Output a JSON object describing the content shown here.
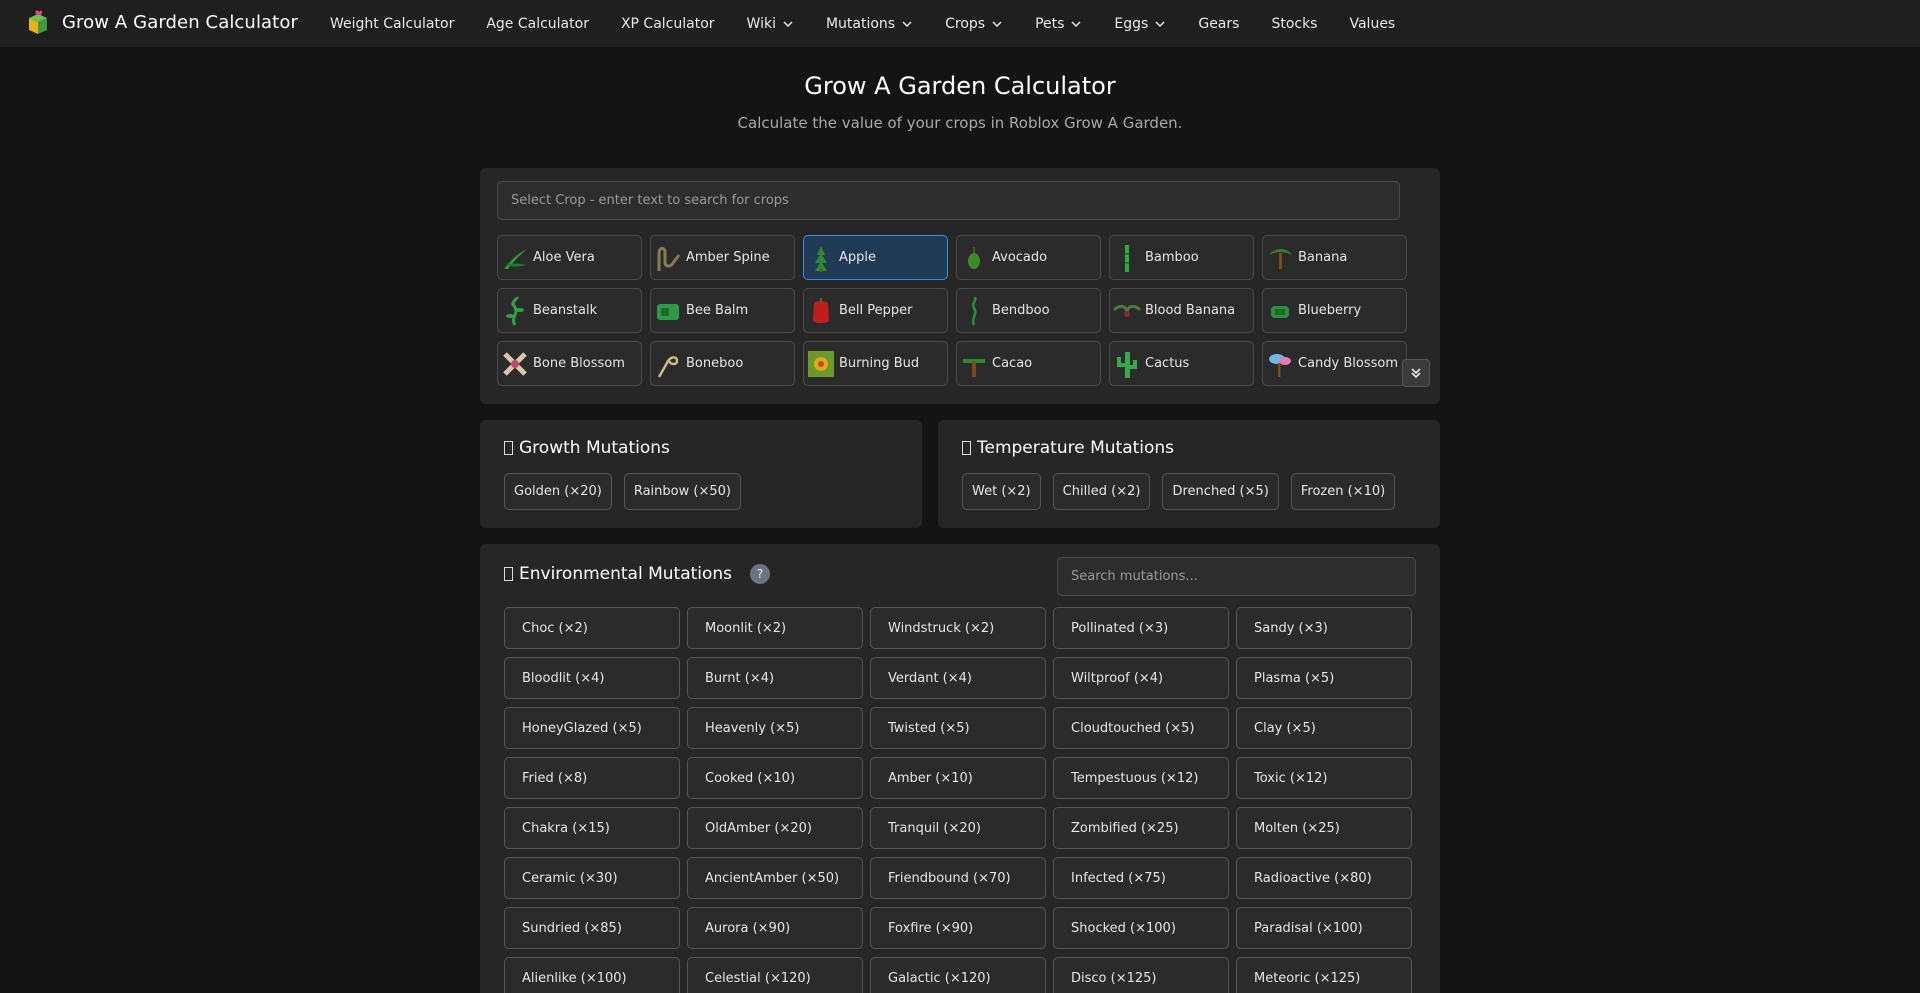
{
  "brand": {
    "title": "Grow A Garden Calculator"
  },
  "nav": [
    {
      "label": "Weight Calculator",
      "dropdown": false
    },
    {
      "label": "Age Calculator",
      "dropdown": false
    },
    {
      "label": "XP Calculator",
      "dropdown": false
    },
    {
      "label": "Wiki",
      "dropdown": true
    },
    {
      "label": "Mutations",
      "dropdown": true
    },
    {
      "label": "Crops",
      "dropdown": true
    },
    {
      "label": "Pets",
      "dropdown": true
    },
    {
      "label": "Eggs",
      "dropdown": true
    },
    {
      "label": "Gears",
      "dropdown": false
    },
    {
      "label": "Stocks",
      "dropdown": false
    },
    {
      "label": "Values",
      "dropdown": false
    }
  ],
  "header": {
    "title": "Grow A Garden Calculator",
    "subtitle": "Calculate the value of your crops in Roblox Grow A Garden."
  },
  "crop_search": {
    "placeholder": "Select Crop - enter text to search for crops",
    "value": ""
  },
  "selected_crop": "Apple",
  "crops": [
    {
      "label": "Aloe Vera",
      "icon": "aloe-vera-icon",
      "color": "#2e9b3a"
    },
    {
      "label": "Amber Spine",
      "icon": "amber-spine-icon",
      "color": "#8a7a52"
    },
    {
      "label": "Apple",
      "icon": "apple-icon",
      "color": "#2f8a2f"
    },
    {
      "label": "Avocado",
      "icon": "avocado-icon",
      "color": "#3a8a2a"
    },
    {
      "label": "Bamboo",
      "icon": "bamboo-icon",
      "color": "#2bab3a"
    },
    {
      "label": "Banana",
      "icon": "banana-icon",
      "color": "#3c7a2c"
    },
    {
      "label": "Beanstalk",
      "icon": "beanstalk-icon",
      "color": "#34a043"
    },
    {
      "label": "Bee Balm",
      "icon": "bee-balm-icon",
      "color": "#2f9a45"
    },
    {
      "label": "Bell Pepper",
      "icon": "bell-pepper-icon",
      "color": "#c01d1d"
    },
    {
      "label": "Bendboo",
      "icon": "bendboo-icon",
      "color": "#2b8e3a"
    },
    {
      "label": "Blood Banana",
      "icon": "blood-banana-icon",
      "color": "#4a7a3a"
    },
    {
      "label": "Blueberry",
      "icon": "blueberry-icon",
      "color": "#2e8f3d"
    },
    {
      "label": "Bone Blossom",
      "icon": "bone-blossom-icon",
      "color": "#d8c8a8"
    },
    {
      "label": "Boneboo",
      "icon": "boneboo-icon",
      "color": "#c9b98f"
    },
    {
      "label": "Burning Bud",
      "icon": "burning-bud-icon",
      "color": "#e0a81a"
    },
    {
      "label": "Cacao",
      "icon": "cacao-icon",
      "color": "#2f8a2a"
    },
    {
      "label": "Cactus",
      "icon": "cactus-icon",
      "color": "#3aa84a"
    },
    {
      "label": "Candy Blossom",
      "icon": "candy-blossom-icon",
      "color": "#6fb6e8"
    }
  ],
  "growth": {
    "title": "Growth Mutations",
    "items": [
      "Golden (×20)",
      "Rainbow (×50)"
    ]
  },
  "temperature": {
    "title": "Temperature Mutations",
    "items": [
      "Wet (×2)",
      "Chilled (×2)",
      "Drenched (×5)",
      "Frozen (×10)"
    ]
  },
  "environmental": {
    "title": "Environmental Mutations",
    "help": "?",
    "search_placeholder": "Search mutations...",
    "items": [
      "Choc (×2)",
      "Moonlit (×2)",
      "Windstruck (×2)",
      "Pollinated (×3)",
      "Sandy (×3)",
      "Bloodlit (×4)",
      "Burnt (×4)",
      "Verdant (×4)",
      "Wiltproof (×4)",
      "Plasma (×5)",
      "HoneyGlazed (×5)",
      "Heavenly (×5)",
      "Twisted (×5)",
      "Cloudtouched (×5)",
      "Clay (×5)",
      "Fried (×8)",
      "Cooked (×10)",
      "Amber (×10)",
      "Tempestuous (×12)",
      "Toxic (×12)",
      "Chakra (×15)",
      "OldAmber (×20)",
      "Tranquil (×20)",
      "Zombified (×25)",
      "Molten (×25)",
      "Ceramic (×30)",
      "AncientAmber (×50)",
      "Friendbound (×70)",
      "Infected (×75)",
      "Radioactive (×80)",
      "Sundried (×85)",
      "Aurora (×90)",
      "Foxfire (×90)",
      "Shocked (×100)",
      "Paradisal (×100)",
      "Alienlike (×100)",
      "Celestial (×120)",
      "Galactic (×120)",
      "Disco (×125)",
      "Meteoric (×125)"
    ]
  },
  "colors": {
    "background": "#141414",
    "navbar": "#1f1f1f",
    "card": "#262626",
    "selected_border": "#3d8fd6",
    "selected_fill": "#1f3a55"
  }
}
